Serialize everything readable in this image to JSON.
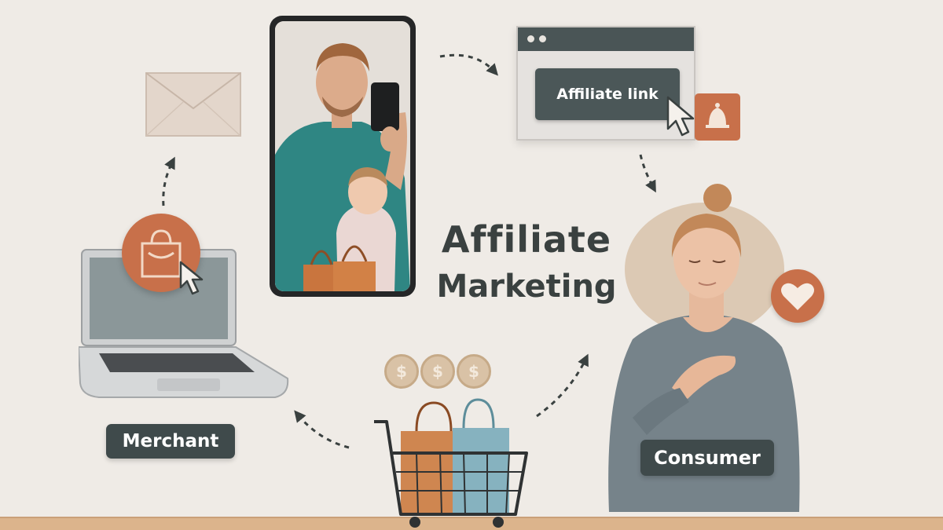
{
  "title": {
    "line1": "Affiliate",
    "line2": "Marketing"
  },
  "browser": {
    "button_label": "Affiliate link"
  },
  "labels": {
    "merchant": "Merchant",
    "consumer": "Consumer"
  },
  "coins": {
    "symbol": "$"
  },
  "icons": {
    "envelope": "envelope-icon",
    "shop": "shopping-bag-icon",
    "cursor": "cursor-arrow-icon",
    "bell": "bell-icon",
    "heart": "heart-icon",
    "cart": "shopping-cart-icon"
  },
  "colors": {
    "background": "#efebe6",
    "terracotta": "#c8704a",
    "slate": "#3f4a4b",
    "text": "#3a4140",
    "shelf": "#dcb48c"
  }
}
